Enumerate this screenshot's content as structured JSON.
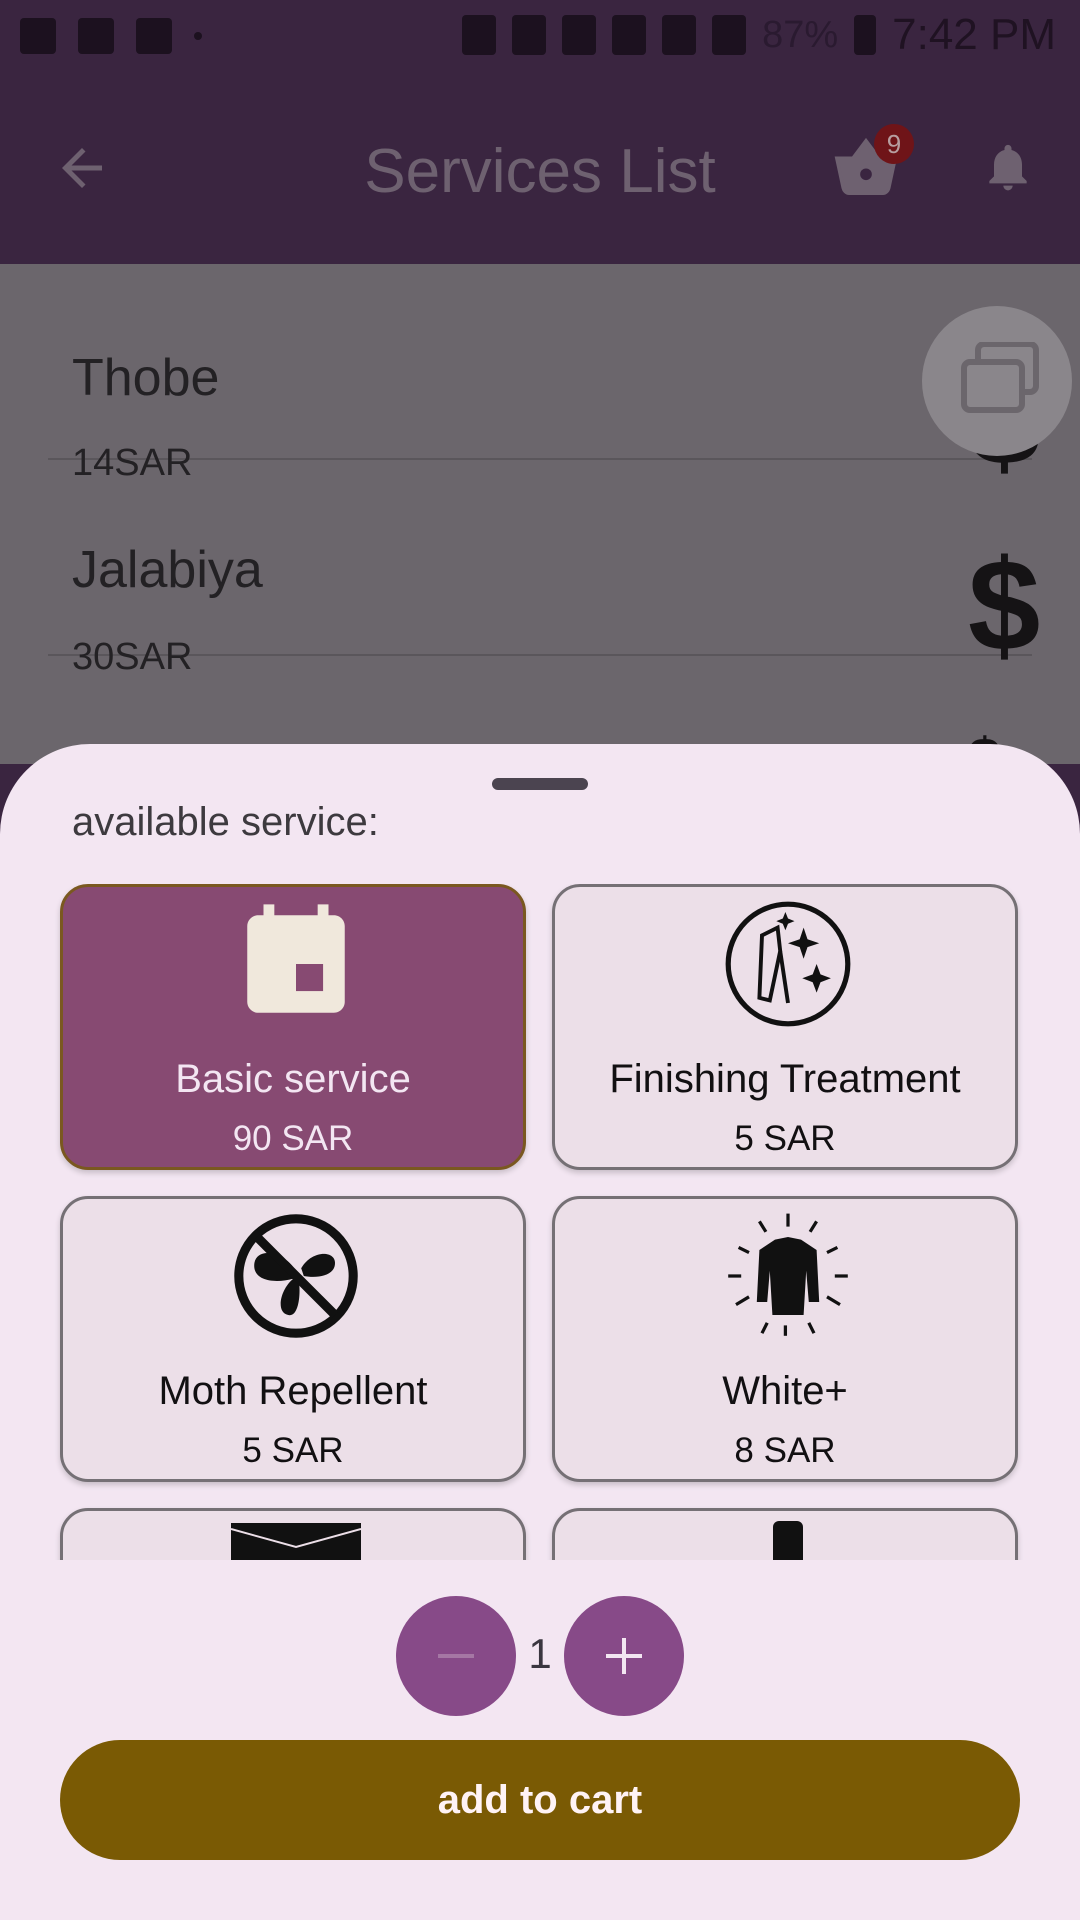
{
  "status_bar": {
    "time": "7:42 PM",
    "battery_percent": "87%"
  },
  "app_bar": {
    "title": "Services List",
    "cart_count": "9"
  },
  "list": {
    "items": [
      {
        "name": "Thobe",
        "price": "14SAR"
      },
      {
        "name": "Jalabiya",
        "price": "30SAR"
      }
    ]
  },
  "sheet": {
    "label": "available service:",
    "services": [
      {
        "title": "Basic service",
        "price": "90 SAR",
        "icon": "calendar-icon",
        "selected": true
      },
      {
        "title": "Finishing Treatment",
        "price": "5 SAR",
        "icon": "sparkle-clothes-icon",
        "selected": false
      },
      {
        "title": "Moth Repellent",
        "price": "5 SAR",
        "icon": "no-moth-icon",
        "selected": false
      },
      {
        "title": "White+",
        "price": "8 SAR",
        "icon": "shining-shirt-icon",
        "selected": false
      }
    ],
    "quantity": "1",
    "add_to_cart_label": "add to cart"
  },
  "colors": {
    "accent": "#874a88",
    "selected_card": "#874a72",
    "add_button": "#7a5a04",
    "sheet_bg": "#f3e6f2"
  }
}
